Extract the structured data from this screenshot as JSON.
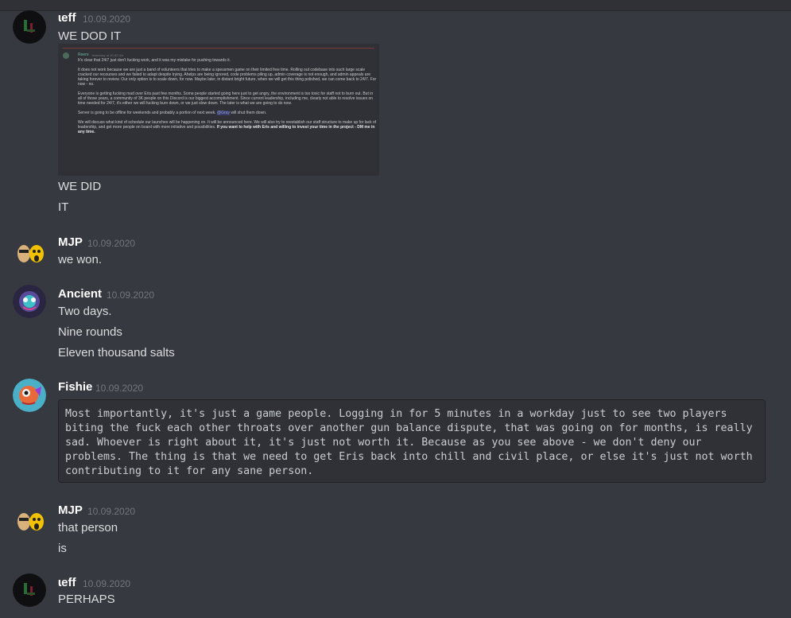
{
  "messages": [
    {
      "author": "ɩeff",
      "timestamp": "10.09.2020",
      "lines": [
        "WE DOD IT",
        "WE DID",
        "IT"
      ],
      "embed": {
        "author": "Reere",
        "time": "Yesterday at 20:52 Uhr",
        "paragraphs": [
          "It's clear that 24/7 just don't fucking work, and it was my mistake for pushing towards it.",
          "It does not work because we are just a band of volunteers that tries to make a spessmen game on their limited free time. Rolling out codebase into such large scale cracked our recourses and we failed to adapt despite trying. Ahelps are being ignored, code problems piling up, admin coverage is not enough, and admin appeals are taking forever to review. Our only option is to scale down, for now. Maybe later, in distant bright future, when we will get this thing polished, we can come back to 24/7. For now - no.",
          "Everyone is getting fucking mad over Eris past few months. Some people started going here just to get angry, the environment is too toxic for staff not to burn out. But in all of those years, a community of 3K people on this Discord is our biggest accomplishment. Since current leadership, including me, clearly not able to resolve issues on time needed for 24/7, it's either we will fucking burn down, or we just slow down. The later is what we are going to do now.",
          "Server is going to be offline for weekends and probably a portion of next week.",
          "will shut them down.",
          "We will discuss what kind of schedule our launches will be happening on. It will be announced here. We will also try to reestablish our staff structure to make up for lack of leadership, and get more people on board with more initiative and possibilities.",
          "If you want to help with Eris and willing to invest your time in the project - DM me in any time."
        ],
        "mention": "@Gray"
      }
    },
    {
      "author": "MJP",
      "timestamp": "10.09.2020",
      "lines": [
        "we won."
      ]
    },
    {
      "author": "Ancient",
      "timestamp": "10.09.2020",
      "lines": [
        "Two days.",
        "Nine rounds",
        "Eleven thousand salts"
      ]
    },
    {
      "author": "Fishie",
      "timestamp": "10.09.2020",
      "code_lines": [
        "Most importantly, it's just a game people. Logging in for 5 minutes in a workday just to see two players",
        "biting the fuck each other throats over another gun balance dispute, that was going on for months, is really",
        "sad. Whoever is right about it, it's just not worth it. Because as you see above - we don't deny our",
        "problems. The thing is that we need to get Eris back into chill and civil place, or else it's just not worth",
        "contributing to it for any sane person."
      ]
    },
    {
      "author": "MJP",
      "timestamp": "10.09.2020",
      "lines": [
        "that person",
        "is"
      ]
    },
    {
      "author": "ɩeff",
      "timestamp": "10.09.2020",
      "lines": [
        "PERHAPS"
      ]
    }
  ]
}
